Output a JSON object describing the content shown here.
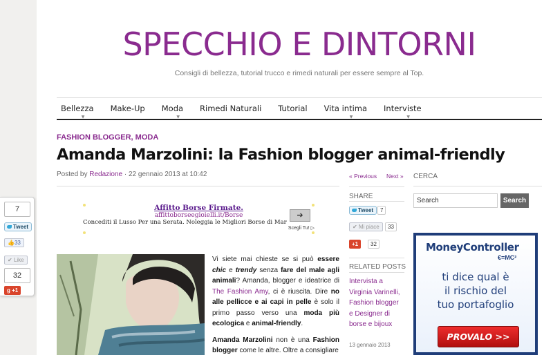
{
  "site": {
    "title": "SPECCHIO E DINTORNI",
    "tagline": "Consigli di bellezza, tutorial trucco e rimedi naturali per essere sempre al Top.",
    "brand_color": "#8a2b8f"
  },
  "nav": {
    "items": [
      {
        "label": "Bellezza",
        "has_submenu": true
      },
      {
        "label": "Make-Up",
        "has_submenu": false
      },
      {
        "label": "Moda",
        "has_submenu": true
      },
      {
        "label": "Rimedi Naturali",
        "has_submenu": false
      },
      {
        "label": "Tutorial",
        "has_submenu": false
      },
      {
        "label": "Vita intima",
        "has_submenu": true
      },
      {
        "label": "Interviste",
        "has_submenu": true
      }
    ]
  },
  "post": {
    "categories": "FASHION BLOGGER, MODA",
    "title": "Amanda Marzolini: la Fashion blogger animal-friendly",
    "meta_prefix": "Posted by",
    "author": "Redazione",
    "date": "22 gennaio 2013 at 10:42",
    "p1_a": "Vi siete mai chieste se si può",
    "p1_b": "essere",
    "p1_c": "chic",
    "p1_d": "e",
    "p1_e": "trendy",
    "p1_f": "senza",
    "p1_g": "fare del male agli animali",
    "p1_h": "? Amanda,",
    "p1_i": "blogger e ideatrice di",
    "p1_link": "The Fashion Amy",
    "p1_j": ", ci è riuscita. Dire",
    "p1_k": "no alle pellicce e ai capi in pelle",
    "p1_l": "è solo il primo passo verso una",
    "p1_m": "moda più ecologica",
    "p1_n": "e",
    "p1_o": "animal-friendly",
    "p1_p": ".",
    "p2_a": "Amanda Marzolini",
    "p2_b": "non è una",
    "p2_c": "Fashion blogger",
    "p2_d": "come le altre. Oltre a consigliare"
  },
  "ad": {
    "title": "Affitto Borse Firmate.",
    "url": "affittoborseegioielli.it/Borse",
    "text": "Concediti il Lusso Per una Serata. Noleggia le Migliori Borse di Marca",
    "arrow": "➔",
    "cta": "Scegli Tu!",
    "adchoice": "▷"
  },
  "sharebar": {
    "prev": "« Previous",
    "next": "Next »",
    "share_label": "SHARE",
    "tweet_label": "Tweet",
    "tweet_count": "7",
    "like_label": "Mi piace",
    "like_count": "33",
    "gplus_label": "+1",
    "gplus_count": "32",
    "related_label": "RELATED POSTS",
    "related_title": "Intervista a Virginia Varinelli, Fashion blogger e Designer di borse e bijoux",
    "related_date": "13 gennaio 2013"
  },
  "sidebar": {
    "search_label": "CERCA",
    "search_placeholder": "Search",
    "search_button": "Search",
    "banner": {
      "logo": "MoneyController",
      "sub": "€=MC²",
      "line1": "ti dice qual è",
      "line2": "il rischio del",
      "line3": "tuo portafoglio",
      "cta": "PROVALO >>"
    }
  },
  "floating_share": {
    "tweet_count": "7",
    "tweet_label": "Tweet",
    "like_count": "33",
    "like_label": "Like",
    "gplus_count": "32",
    "gplus_label": "+1"
  }
}
